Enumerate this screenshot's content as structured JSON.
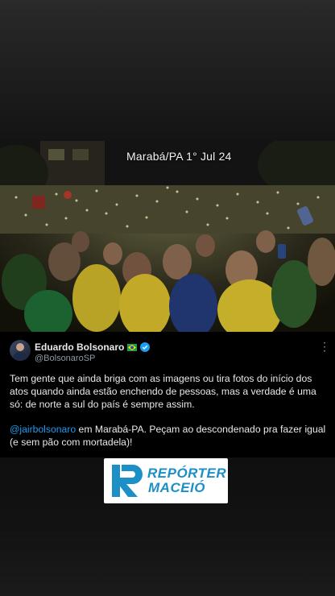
{
  "video": {
    "caption": "Marabá/PA 1° Jul 24"
  },
  "post": {
    "display_name": "Eduardo Bolsonaro",
    "flag_icon": "brazil-flag-icon",
    "verified_icon": "verified-badge-icon",
    "handle": "@BolsonaroSP",
    "more_icon": "more-options-icon",
    "paragraph1": "Tem gente que ainda briga com as imagens ou tira fotos do início dos atos quando ainda estão enchendo de pessoas, mas a verdade é uma só: de norte a sul do país é sempre assim.",
    "mention": "@jairbolsonaro",
    "paragraph2_rest": " em Marabá-PA. Peçam ao descondenado pra fazer igual (e sem pão com mortadela)!"
  },
  "watermark": {
    "line1": "REPÓRTER",
    "line2": "MACEIÓ"
  },
  "colors": {
    "link": "#1d9bf0",
    "verified": "#1d9bf0",
    "logo_blue": "#1c8fc7"
  }
}
